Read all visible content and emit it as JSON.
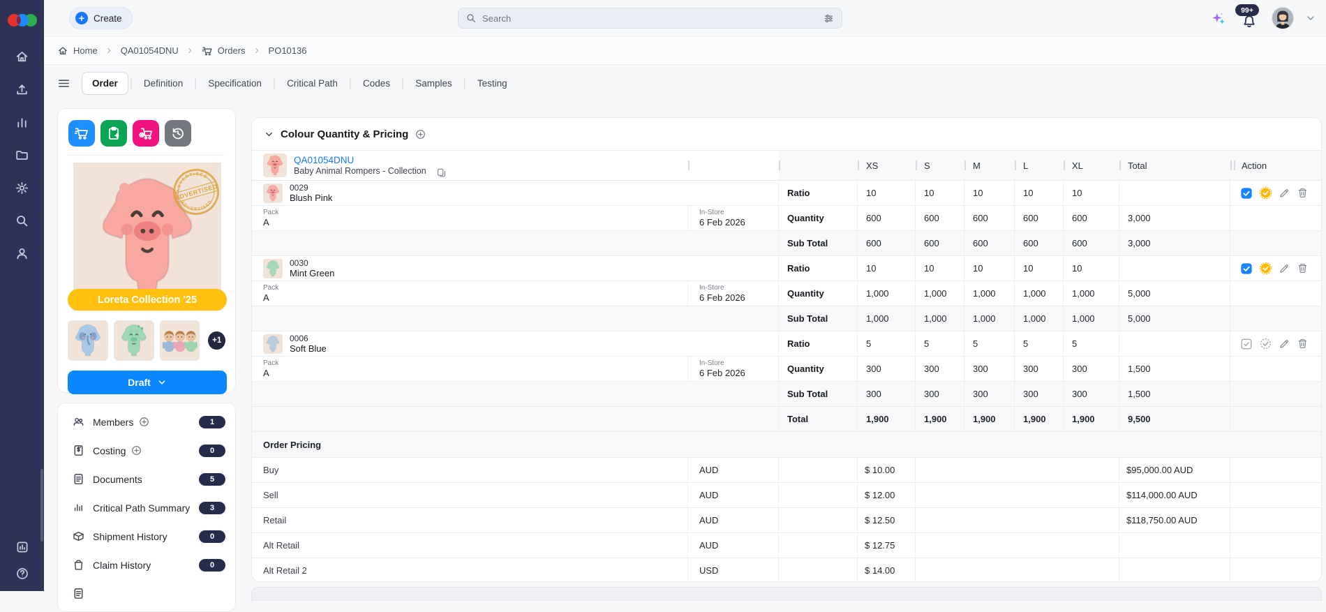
{
  "colors": {
    "accent_blue": "#1677ff",
    "navy": "#2d3256",
    "badge_navy": "#272c4d",
    "banner_yellow": "#ffc10d",
    "btn_blue": "#1f8fff",
    "btn_green": "#0aa553",
    "btn_pink": "#f31380",
    "btn_gray": "#74787e",
    "seal_gold": "#ffb800",
    "stamp_gold": "#d9a33c",
    "draft_blue": "#0b87ff",
    "link_blue": "#1677ff"
  },
  "rail": {
    "icons": [
      "home",
      "upload",
      "analytics",
      "folder",
      "settings",
      "search",
      "profile"
    ],
    "bottom_icons": [
      "reports",
      "help"
    ],
    "logo": "brand-logo"
  },
  "topbar": {
    "create_label": "Create",
    "search_placeholder": "Search",
    "notification_count": "99+",
    "icons": [
      "sparkle-ai",
      "bell",
      "avatar",
      "chevron-down"
    ]
  },
  "breadcrumb": {
    "items": [
      {
        "label": "Home",
        "icon": "home"
      },
      {
        "label": "QA01054DNU"
      },
      {
        "label": "Orders",
        "icon": "cart"
      },
      {
        "label": "PO10136"
      }
    ]
  },
  "tabs": {
    "items": [
      {
        "label": "Order",
        "active": true
      },
      {
        "label": "Definition",
        "active": false
      },
      {
        "label": "Specification",
        "active": false
      },
      {
        "label": "Critical Path",
        "active": false
      },
      {
        "label": "Codes",
        "active": false
      },
      {
        "label": "Samples",
        "active": false
      },
      {
        "label": "Testing",
        "active": false
      }
    ]
  },
  "product_panel": {
    "action_buttons": [
      {
        "icon": "cart",
        "color": "#1f8fff"
      },
      {
        "icon": "clipboard-add",
        "color": "#0aa553"
      },
      {
        "icon": "cart-remove",
        "color": "#f31380"
      },
      {
        "icon": "history",
        "color": "#74787e"
      }
    ],
    "stamp_text": "ADVERTISED",
    "banner_label": "Loreta Collection '25",
    "thumbnails": [
      "romper-elephant-blue",
      "romper-dino-green",
      "babies-photo"
    ],
    "extra_images_count": "+1",
    "status_label": "Draft"
  },
  "summary_panel": {
    "items": [
      {
        "icon": "members",
        "label": "Members",
        "count": "1",
        "has_add": true
      },
      {
        "icon": "costing",
        "label": "Costing",
        "count": "0",
        "has_add": true
      },
      {
        "icon": "documents",
        "label": "Documents",
        "count": "5",
        "has_add": false
      },
      {
        "icon": "critical-path",
        "label": "Critical Path Summary",
        "count": "3",
        "has_add": false
      },
      {
        "icon": "shipment",
        "label": "Shipment History",
        "count": "0",
        "has_add": false
      },
      {
        "icon": "claim",
        "label": "Claim History",
        "count": "0",
        "has_add": false
      },
      {
        "icon": "documents",
        "label": "",
        "count": "",
        "has_add": false
      }
    ]
  },
  "section": {
    "title": "Colour Quantity & Pricing"
  },
  "order_table": {
    "product": {
      "code": "QA01054DNU",
      "name": "Baby Animal Rompers - Collection"
    },
    "sizes": [
      "XS",
      "S",
      "M",
      "L",
      "XL"
    ],
    "total_label": "Total",
    "action_label": "Action",
    "row_labels": {
      "ratio": "Ratio",
      "quantity": "Quantity",
      "sub_total": "Sub Total",
      "pack": "Pack",
      "in_store": "In-Store"
    },
    "colour_groups": [
      {
        "code": "0029",
        "name": "Blush Pink",
        "tint": "#f5ada6",
        "ratio": [
          "10",
          "10",
          "10",
          "10",
          "10"
        ],
        "pack": "A",
        "in_store": "6 Feb 2026",
        "quantity": [
          "600",
          "600",
          "600",
          "600",
          "600"
        ],
        "quantity_total": "3,000",
        "sub_total": [
          "600",
          "600",
          "600",
          "600",
          "600"
        ],
        "sub_total_total": "3,000",
        "approved": true
      },
      {
        "code": "0030",
        "name": "Mint Green",
        "tint": "#a5d8b4",
        "ratio": [
          "10",
          "10",
          "10",
          "10",
          "10"
        ],
        "pack": "A",
        "in_store": "6 Feb 2026",
        "quantity": [
          "1,000",
          "1,000",
          "1,000",
          "1,000",
          "1,000"
        ],
        "quantity_total": "5,000",
        "sub_total": [
          "1,000",
          "1,000",
          "1,000",
          "1,000",
          "1,000"
        ],
        "sub_total_total": "5,000",
        "approved": true
      },
      {
        "code": "0006",
        "name": "Soft Blue",
        "tint": "#b9cbde",
        "ratio": [
          "5",
          "5",
          "5",
          "5",
          "5"
        ],
        "pack": "A",
        "in_store": "6 Feb 2026",
        "quantity": [
          "300",
          "300",
          "300",
          "300",
          "300"
        ],
        "quantity_total": "1,500",
        "sub_total": [
          "300",
          "300",
          "300",
          "300",
          "300"
        ],
        "sub_total_total": "1,500",
        "approved": false
      }
    ],
    "grand_total": {
      "label": "Total",
      "values": [
        "1,900",
        "1,900",
        "1,900",
        "1,900",
        "1,900"
      ],
      "total": "9,500"
    }
  },
  "pricing": {
    "title": "Order Pricing",
    "rows": [
      {
        "label": "Buy",
        "currency": "AUD",
        "unit_price": "$ 10.00",
        "total": "$95,000.00 AUD"
      },
      {
        "label": "Sell",
        "currency": "AUD",
        "unit_price": "$ 12.00",
        "total": "$114,000.00 AUD"
      },
      {
        "label": "Retail",
        "currency": "AUD",
        "unit_price": "$ 12.50",
        "total": "$118,750.00 AUD"
      },
      {
        "label": "Alt Retail",
        "currency": "AUD",
        "unit_price": "$ 12.75",
        "total": ""
      },
      {
        "label": "Alt Retail 2",
        "currency": "USD",
        "unit_price": "$ 14.00",
        "total": ""
      }
    ]
  }
}
